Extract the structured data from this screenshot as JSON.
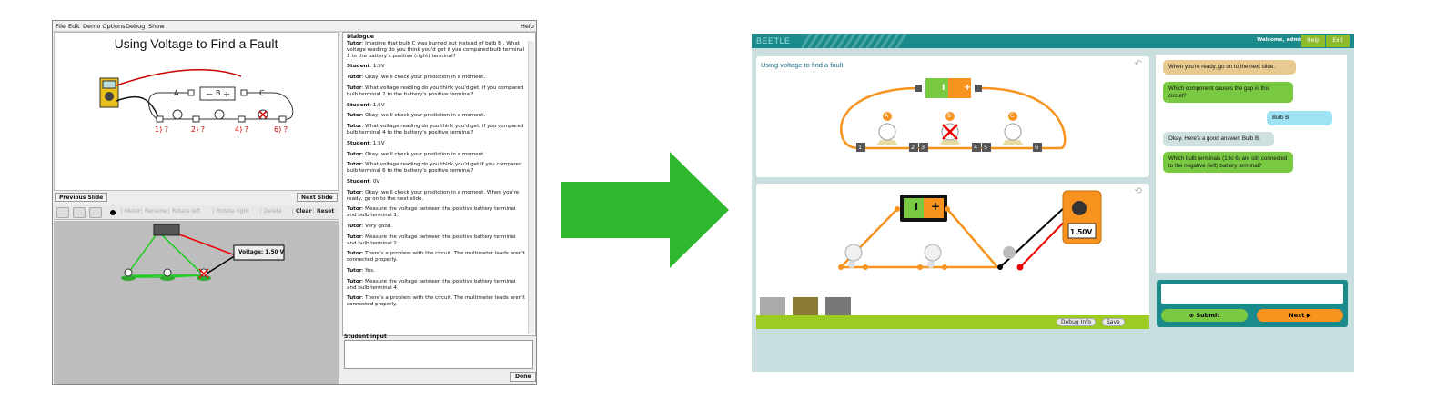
{
  "left_app": {
    "menu": [
      "File",
      "Edit",
      "Demo Options",
      "Debug",
      "Show"
    ],
    "menu_help": "Help",
    "slide_title": "Using Voltage to Find a Fault",
    "bulb_labels": [
      "A",
      "B",
      "C"
    ],
    "question_labels": [
      "1) ?",
      "2) ?",
      "4) ?",
      "6) ?"
    ],
    "prev_slide": "Previous Slide",
    "next_slide": "Next Slide",
    "toolbar": {
      "meter": "Meter",
      "rename": "Rename",
      "rotate_left": "Rotate left",
      "rotate_right": "Rotate right",
      "delete": "Delete",
      "clear": "Clear",
      "reset": "Reset"
    },
    "voltage_readout": "Voltage: 1.50 V",
    "dialogue_title": "Dialogue",
    "dialogue": [
      {
        "speaker": "Tutor",
        "text": "Imagine that bulb C was burned out instead of bulb B .  What voltage reading do you think you'd get if you compared bulb terminal 1 to the battery's positive (right) terminal?"
      },
      {
        "speaker": "Student",
        "text": "1.5V"
      },
      {
        "speaker": "Tutor",
        "text": "Okay, we'll check your prediction in a moment."
      },
      {
        "speaker": "Tutor",
        "text": "What voltage reading do you think you'd get, if you compared bulb terminal 2 to the battery's positive terminal?"
      },
      {
        "speaker": "Student",
        "text": "1.5V"
      },
      {
        "speaker": "Tutor",
        "text": "Okay, we'll check your prediction in a moment."
      },
      {
        "speaker": "Tutor",
        "text": "What voltage reading do you think you'd get, if you compared bulb terminal 4 to the battery's positive terminal?"
      },
      {
        "speaker": "Student",
        "text": "1.5V"
      },
      {
        "speaker": "Tutor",
        "text": "Okay, we'll check your prediction in a moment."
      },
      {
        "speaker": "Tutor",
        "text": "What voltage reading do you think you'd get if you compared bulb terminal 6 to the battery's positive terminal?"
      },
      {
        "speaker": "Student",
        "text": "0V"
      },
      {
        "speaker": "Tutor",
        "text": "Okay, we'll check your prediction in a moment.  When you're ready, go on to the next slide."
      },
      {
        "speaker": "Tutor",
        "text": "Measure the voltage between the positive battery terminal and bulb terminal 1."
      },
      {
        "speaker": "Tutor",
        "text": "Very good."
      },
      {
        "speaker": "Tutor",
        "text": "Measure the voltage between the positive battery terminal and bulb terminal 2."
      },
      {
        "speaker": "Tutor",
        "text": "There's a problem with the circuit.  The multimeter leads aren't connected properly."
      },
      {
        "speaker": "Tutor",
        "text": "Yes."
      },
      {
        "speaker": "Tutor",
        "text": "Measure the voltage between the positive battery terminal and bulb terminal 4."
      },
      {
        "speaker": "Tutor",
        "text": "There's a problem with the circuit.  The multimeter leads aren't connected properly."
      }
    ],
    "student_input_label": "Student input",
    "done": "Done"
  },
  "right_app": {
    "logo": "BEETLE",
    "welcome": "Welcome, admin1",
    "help": "Help",
    "exit": "Exit",
    "slide_title": "Using voltage to find a fault",
    "bulb_labels": [
      "A",
      "B",
      "C"
    ],
    "terminal_labels": [
      "1",
      "2",
      "3",
      "4",
      "5",
      "6"
    ],
    "battery_minus": "I",
    "battery_plus": "+",
    "meter_reading": "1.50V",
    "debug_info": "Debug Info",
    "save": "Save",
    "chat": [
      {
        "from": "tutor",
        "text": "When you're ready, go on to the next slide."
      },
      {
        "from": "tutor",
        "text": "Which component causes the gap in this circuit?"
      },
      {
        "from": "student",
        "text": "Bulb B"
      },
      {
        "from": "tutor",
        "text": "Okay. Here's a good answer: Bulb B."
      },
      {
        "from": "tutor",
        "text": "Which bulb terminals (1 to 6) are still connected to the negative (left) battery terminal?"
      }
    ],
    "submit": "Submit",
    "next": "Next"
  },
  "colors": {
    "teal": "#1b8a8a",
    "green": "#7ac943",
    "orange": "#f7931e",
    "arrow": "#2eb82e"
  }
}
